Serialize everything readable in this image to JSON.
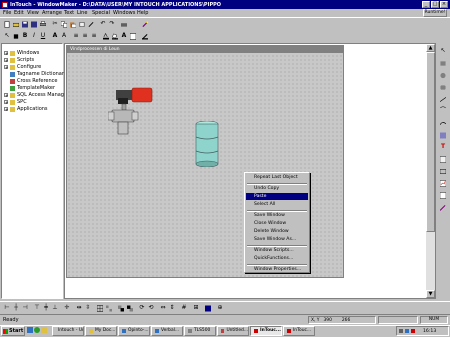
{
  "window": {
    "title": "InTouch - WindowMaker - D:\\DATA\\USER\\MY INTOUCH APPLICATIONS\\PIPPO",
    "runtime_label": "Runtime!"
  },
  "menu": [
    "File",
    "Edit",
    "View",
    "Arrange",
    "Text",
    "Line",
    "Special",
    "Windows",
    "Help"
  ],
  "tree": {
    "items": [
      {
        "label": "Windows",
        "expand": "+"
      },
      {
        "label": "Scripts",
        "expand": "+"
      },
      {
        "label": "Configure",
        "expand": "+"
      },
      {
        "label": "Tagname Dictionary",
        "expand": ""
      },
      {
        "label": "Cross Reference",
        "expand": ""
      },
      {
        "label": "TemplateMaker",
        "expand": ""
      },
      {
        "label": "SQL Access Manager",
        "expand": "+"
      },
      {
        "label": "SPC",
        "expand": "+"
      },
      {
        "label": "Applications",
        "expand": "+"
      }
    ]
  },
  "canvas": {
    "title": "Vindprocessen di Leun"
  },
  "context_menu": {
    "groups": [
      [
        "Repeat Last Object"
      ],
      [
        "Undo Copy",
        "Paste",
        "Select All"
      ],
      [
        "Save Window",
        "Close Window",
        "Delete Window",
        "Save Window As..."
      ],
      [
        "Window Scripts...",
        "QuickFunctions..."
      ],
      [
        "Window Properties..."
      ]
    ],
    "highlighted": "Paste"
  },
  "status": {
    "left": "Ready",
    "coords_label": "X, Y",
    "x": "390",
    "y": "266",
    "num": "NUM"
  },
  "taskbar": {
    "start": "Start",
    "buttons": [
      "Intouch - Untit...",
      "My Doc...",
      "Opinto-...",
      "Verbal...",
      "TLS500",
      "Untitled...",
      "InTouc...",
      "InTouc..."
    ],
    "active_index": 6,
    "clock": "16:13"
  },
  "colors": {
    "titlebar": "#000080",
    "selection": "#000080",
    "canvas_bg": "#c8c8c8",
    "valve_red": "#e03020",
    "drum": "#8fd4cc"
  }
}
